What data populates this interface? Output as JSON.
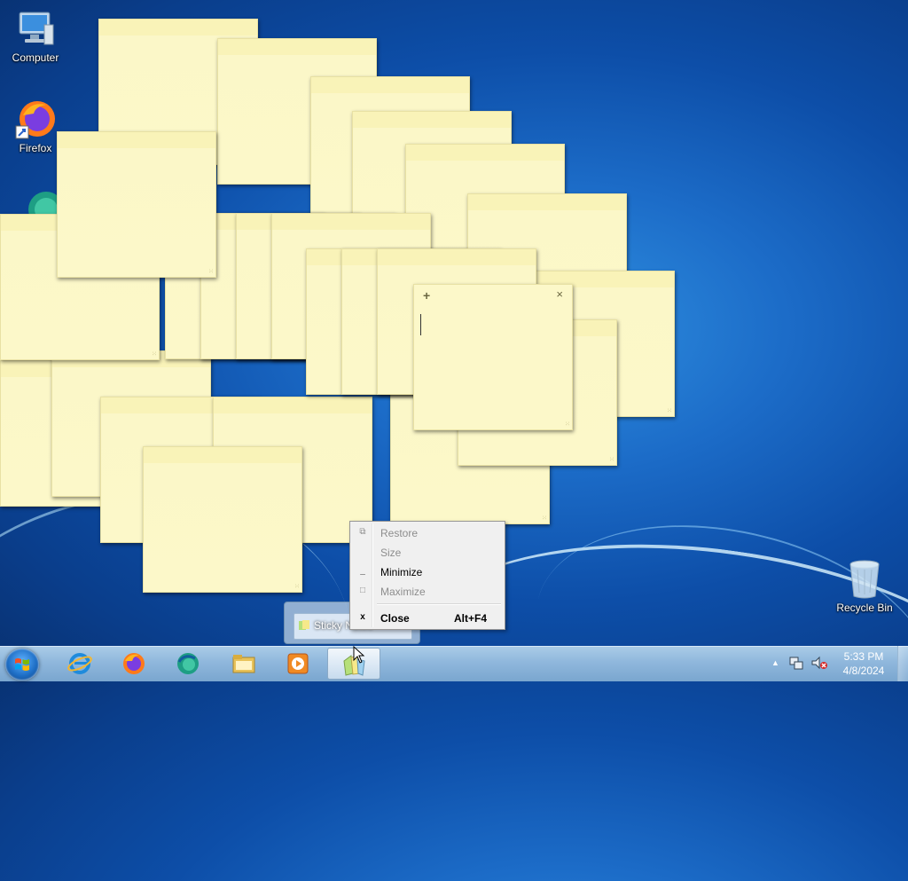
{
  "desktop": {
    "icons": [
      {
        "label": "Computer",
        "icon": "computer-icon"
      },
      {
        "label": "Firefox",
        "icon": "firefox-icon"
      },
      {
        "label": "Recycle Bin",
        "icon": "recycle-bin-icon"
      }
    ]
  },
  "sticky_notes": {
    "active_note": {
      "new_note_glyph": "+",
      "close_glyph": "×"
    }
  },
  "taskbar_thumbnail": {
    "title": "Sticky Notes"
  },
  "context_menu": {
    "items": [
      {
        "label": "Restore",
        "enabled": false,
        "icon": "restore-icon"
      },
      {
        "label": "Size",
        "enabled": false,
        "icon": ""
      },
      {
        "label": "Minimize",
        "enabled": true,
        "icon": "minimize-icon"
      },
      {
        "label": "Maximize",
        "enabled": false,
        "icon": "maximize-icon"
      },
      {
        "label": "Close",
        "enabled": true,
        "shortcut": "Alt+F4",
        "icon": "close-icon"
      }
    ]
  },
  "taskbar": {
    "pinned": [
      "internet-explorer-icon",
      "firefox-icon",
      "edge-icon",
      "file-explorer-icon",
      "media-player-icon",
      "sticky-notes-icon"
    ],
    "clock": {
      "time": "5:33 PM",
      "date": "4/8/2024"
    }
  },
  "colors": {
    "note_yellow": "#fcf8c9",
    "taskbar": "#8fb7dc",
    "desktop_blue": "#1c6cc8"
  }
}
